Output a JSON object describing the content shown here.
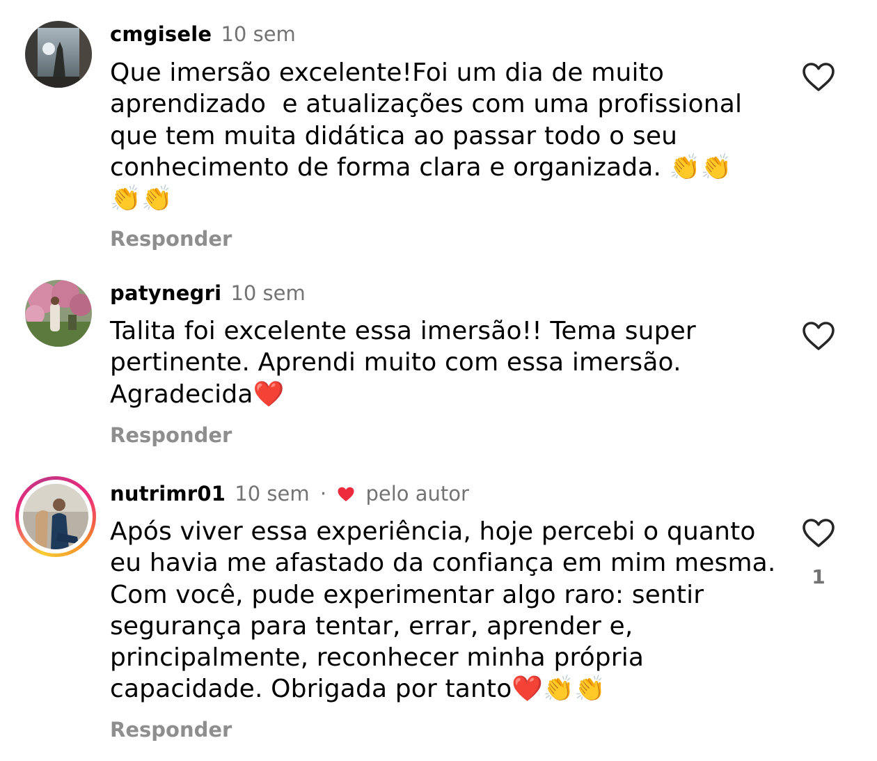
{
  "comments": [
    {
      "username": "cmgisele",
      "time": "10 sem",
      "text": "Que imersão excelente!Foi um dia de muito\naprendizado  e atualizações com uma profissional\nque tem muita didática ao passar todo o seu\nconhecimento de forma clara e organizada. 👏👏\n👏👏",
      "reply_label": "Responder",
      "like_icon": "heart-outline-icon"
    },
    {
      "username": "patynegri",
      "time": "10 sem",
      "text": "Talita foi excelente essa imersão!! Tema super\npertinente. Aprendi muito com essa imersão.\nAgradecida❤️",
      "reply_label": "Responder",
      "like_icon": "heart-outline-icon"
    },
    {
      "username": "nutrimr01",
      "time": "10 sem",
      "separator": "·",
      "liked_by_author_label": "pelo autor",
      "text": "Após viver essa experiência, hoje percebi o quanto\neu havia me afastado da confiança em mim mesma.\nCom você, pude experimentar algo raro: sentir\nsegurança para tentar, errar, aprender e,\nprincipalmente, reconhecer minha própria\ncapacidade. Obrigada por tanto❤️👏👏",
      "reply_label": "Responder",
      "like_icon": "heart-outline-icon",
      "like_count": "1"
    }
  ],
  "colors": {
    "secondary_text": "#737373",
    "reply_text": "#8e8e8e",
    "heart_red": "#ed2b3d"
  }
}
